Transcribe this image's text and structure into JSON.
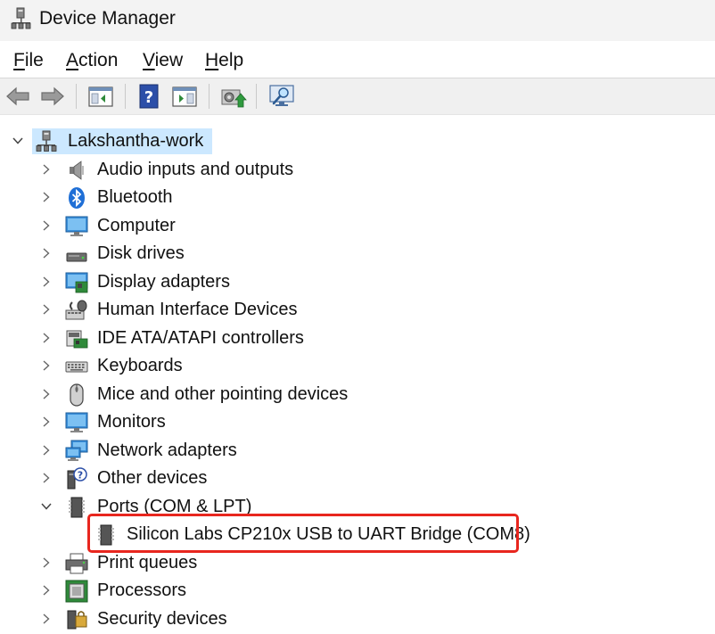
{
  "window": {
    "title": "Device Manager"
  },
  "menu": [
    {
      "label": "File",
      "underline": "F",
      "rest": "ile"
    },
    {
      "label": "Action",
      "underline": "A",
      "rest": "ction"
    },
    {
      "label": "View",
      "underline": "V",
      "rest": "iew"
    },
    {
      "label": "Help",
      "underline": "H",
      "rest": "elp"
    }
  ],
  "toolbar": {
    "buttons": [
      "back-arrow-icon",
      "forward-arrow-icon",
      "console-tree-icon",
      "help-icon",
      "action-pane-icon",
      "update-driver-icon",
      "scan-hardware-icon"
    ]
  },
  "tree": {
    "root": {
      "label": "Lakshantha-work",
      "expanded": true
    },
    "categories": [
      {
        "label": "Audio inputs and outputs",
        "icon": "speaker-icon"
      },
      {
        "label": "Bluetooth",
        "icon": "bluetooth-icon"
      },
      {
        "label": "Computer",
        "icon": "computer-icon"
      },
      {
        "label": "Disk drives",
        "icon": "disk-drive-icon"
      },
      {
        "label": "Display adapters",
        "icon": "display-adapter-icon"
      },
      {
        "label": "Human Interface Devices",
        "icon": "hid-icon"
      },
      {
        "label": "IDE ATA/ATAPI controllers",
        "icon": "ide-controller-icon"
      },
      {
        "label": "Keyboards",
        "icon": "keyboard-icon"
      },
      {
        "label": "Mice and other pointing devices",
        "icon": "mouse-icon"
      },
      {
        "label": "Monitors",
        "icon": "monitor-icon"
      },
      {
        "label": "Network adapters",
        "icon": "network-adapter-icon"
      },
      {
        "label": "Other devices",
        "icon": "other-devices-icon"
      },
      {
        "label": "Ports (COM & LPT)",
        "icon": "port-icon",
        "expanded": true,
        "children": [
          {
            "label": "Silicon Labs CP210x USB to UART Bridge (COM8)",
            "icon": "port-icon",
            "highlighted": true
          }
        ]
      },
      {
        "label": "Print queues",
        "icon": "printer-icon"
      },
      {
        "label": "Processors",
        "icon": "processor-icon"
      },
      {
        "label": "Security devices",
        "icon": "security-device-icon"
      }
    ]
  },
  "colors": {
    "selection": "#cce8ff",
    "highlight_box": "#e8261e",
    "titlebar": "#f3f3f3",
    "toolbar": "#f0f0f0"
  }
}
